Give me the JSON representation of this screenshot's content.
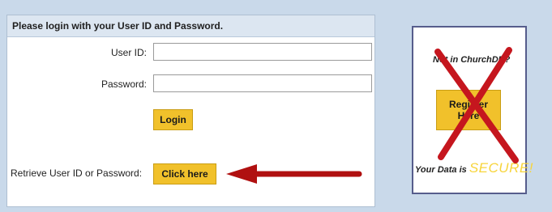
{
  "login": {
    "header": "Please login with your User ID and Password.",
    "userid_label": "User ID:",
    "userid_value": "",
    "password_label": "Password:",
    "password_value": "",
    "login_button": "Login",
    "retrieve_label": "Retrieve User ID or Password:",
    "click_here_button": "Click here"
  },
  "register": {
    "prompt": "Not in ChurchDB?",
    "button": "Register Here",
    "data_label": "Your Data is",
    "secure_text": "SECURE!"
  },
  "annotations": {
    "arrow_color": "#b01010",
    "cross_color": "#c5161e"
  },
  "colors": {
    "button": "#f1c12b",
    "header_bg": "#dce6f1",
    "page_bg": "#c9d9ea",
    "secure": "#f7d43a"
  }
}
